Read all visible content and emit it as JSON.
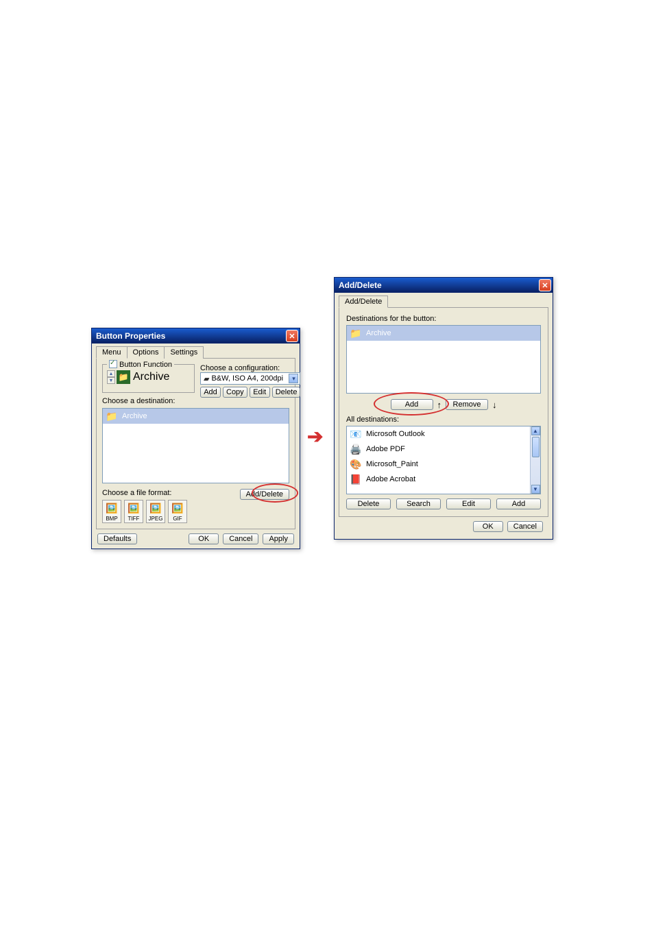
{
  "left": {
    "title": "Button Properties",
    "tabs": [
      "Menu",
      "Options",
      "Settings"
    ],
    "button_function": {
      "legend": "Button Function",
      "checked": true,
      "name": "Archive"
    },
    "choose_config_label": "Choose a configuration:",
    "config_value": "B&W, ISO A4, 200dpi",
    "config_buttons": [
      "Add",
      "Copy",
      "Edit",
      "Delete"
    ],
    "choose_dest_label": "Choose a destination:",
    "dest_item": "Archive",
    "choose_format_label": "Choose a file format:",
    "formats": [
      "BMP",
      "TIFF",
      "JPEG",
      "GIF"
    ],
    "add_delete_btn": "Add/Delete",
    "defaults_btn": "Defaults",
    "bottom": [
      "OK",
      "Cancel",
      "Apply"
    ]
  },
  "right": {
    "title": "Add/Delete",
    "tab": "Add/Delete",
    "dest_for_button_label": "Destinations for the button:",
    "dest_item": "Archive",
    "mid_buttons": {
      "add": "Add",
      "remove": "Remove",
      "up": "↑",
      "down": "↓"
    },
    "all_dest_label": "All destinations:",
    "all_dests": [
      "Microsoft Outlook",
      "Adobe PDF",
      "Microsoft_Paint",
      "Adobe Acrobat"
    ],
    "all_buttons": [
      "Delete",
      "Search",
      "Edit",
      "Add"
    ],
    "bottom": [
      "OK",
      "Cancel"
    ]
  }
}
